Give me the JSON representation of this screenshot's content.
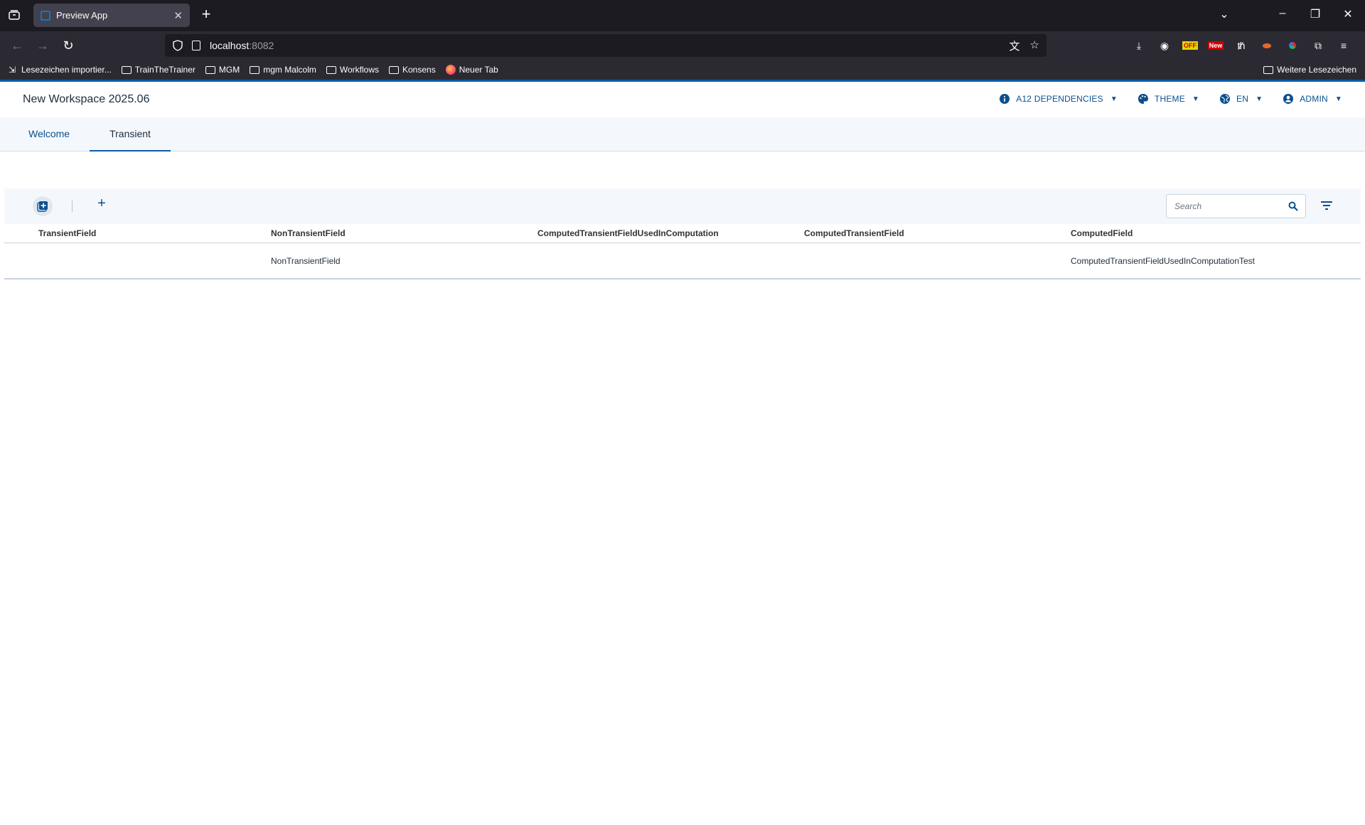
{
  "browser": {
    "tab_title": "Preview App",
    "url_host": "localhost",
    "url_port": ":8082",
    "bookmarks": [
      "Lesezeichen importier...",
      "TrainTheTrainer",
      "MGM",
      "mgm Malcolm",
      "Workflows",
      "Konsens",
      "Neuer Tab"
    ],
    "bookmarks_more": "Weitere Lesezeichen"
  },
  "app": {
    "title": "New Workspace 2025.06",
    "menu": {
      "dependencies": "A12 DEPENDENCIES",
      "theme": "THEME",
      "language": "EN",
      "user": "ADMIN"
    },
    "tabs": [
      "Welcome",
      "Transient"
    ],
    "active_tab": "Transient"
  },
  "toolbar": {
    "search_placeholder": "Search"
  },
  "table": {
    "columns": [
      "TransientField",
      "NonTransientField",
      "ComputedTransientFieldUsedInComputation",
      "ComputedTransientField",
      "ComputedField"
    ],
    "rows": [
      [
        "",
        "NonTransientField",
        "",
        "",
        "ComputedTransientFieldUsedInComputationTest"
      ]
    ]
  }
}
